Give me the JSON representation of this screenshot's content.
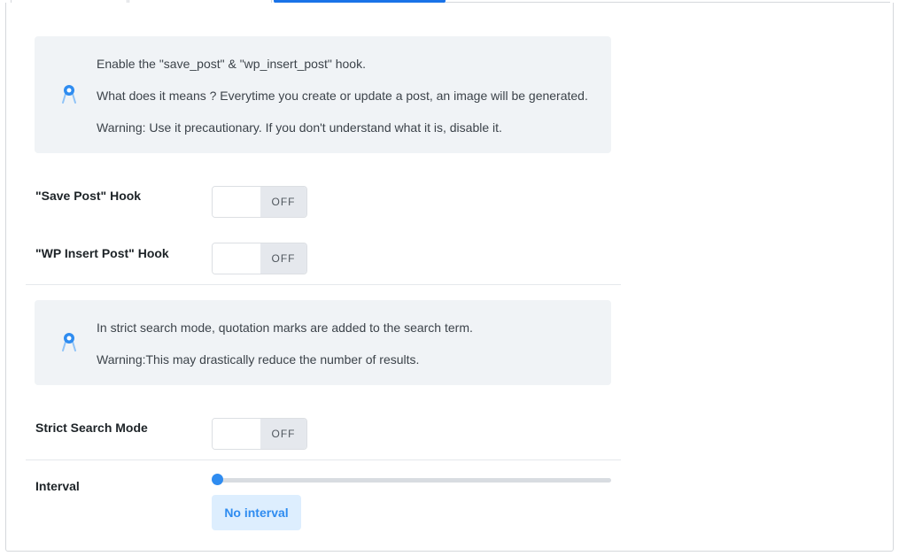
{
  "notice_hooks": {
    "icon": "pin-icon",
    "lines": [
      "Enable the \"save_post\" & \"wp_insert_post\" hook.",
      "What does it means ? Everytime you create or update a post, an image will be generated.",
      "Warning: Use it precautionary. If you don't understand what it is, disable it."
    ]
  },
  "settings": {
    "save_post": {
      "label": "\"Save Post\" Hook",
      "state": "OFF"
    },
    "wp_insert_post": {
      "label": "\"WP Insert Post\" Hook",
      "state": "OFF"
    },
    "strict_search": {
      "label": "Strict Search Mode",
      "state": "OFF"
    }
  },
  "notice_search": {
    "icon": "pin-icon",
    "lines": [
      "In strict search mode, quotation marks are added to the search term.",
      "Warning:This may drastically reduce the number of results."
    ]
  },
  "interval": {
    "label": "Interval",
    "value_text": "No interval",
    "slider_fraction": 0
  },
  "colors": {
    "accent": "#2f8cf0",
    "notice_bg": "#f0f3f6",
    "toggle_off_bg": "#e5e8ed"
  }
}
